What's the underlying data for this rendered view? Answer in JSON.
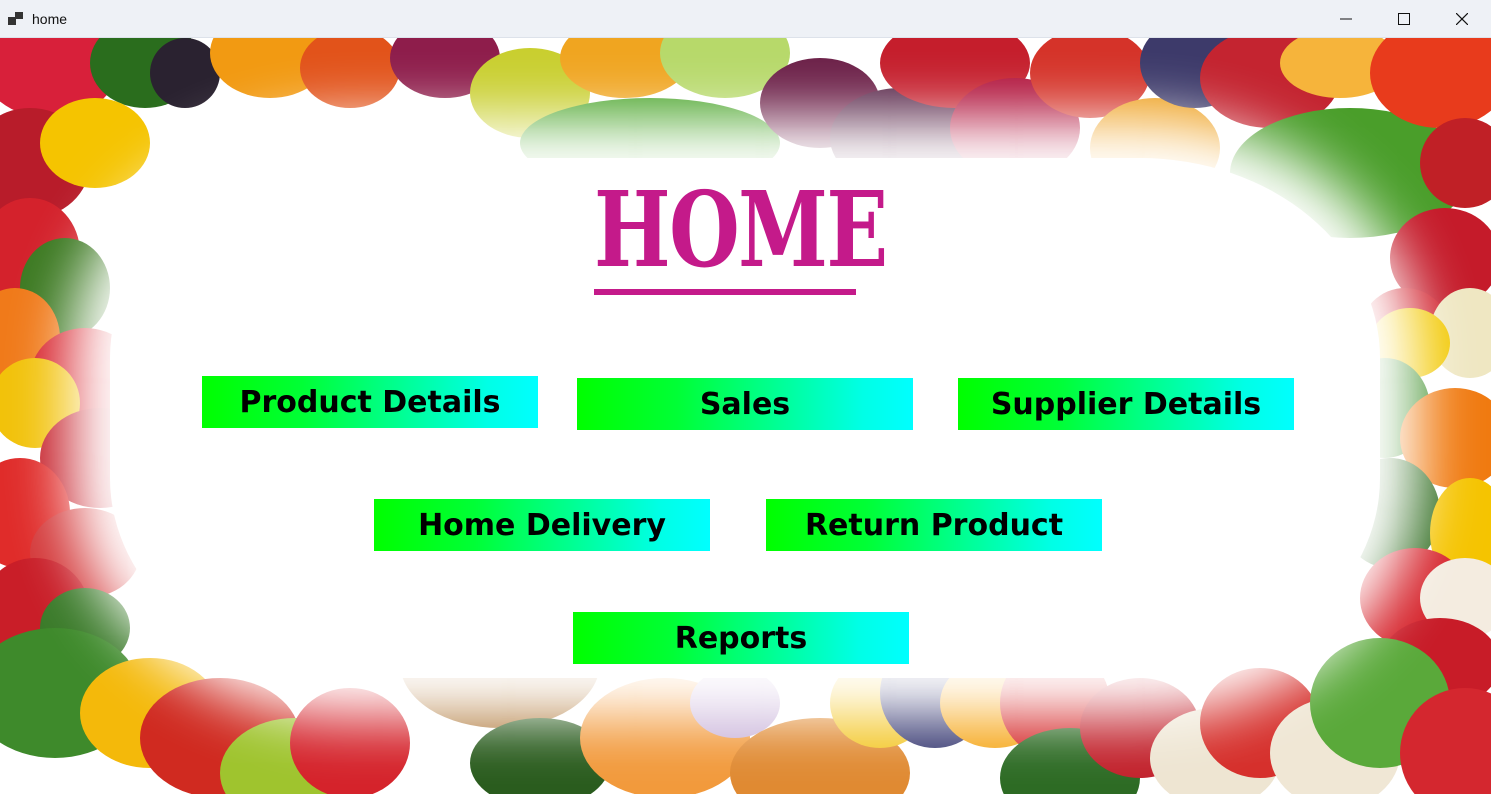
{
  "window": {
    "title": "home",
    "controls": {
      "minimize": "minimize-icon",
      "maximize": "maximize-icon",
      "close": "close-icon"
    }
  },
  "main": {
    "heading": "HOME",
    "buttons": {
      "product_details": "Product Details",
      "sales": "Sales",
      "supplier_details": "Supplier Details",
      "home_delivery": "Home Delivery",
      "return_product": "Return Product",
      "reports": "Reports"
    }
  },
  "colors": {
    "heading": "#c41a8a",
    "button_gradient_start": "#00ff00",
    "button_gradient_end": "#00ffff",
    "button_text": "#000000"
  }
}
